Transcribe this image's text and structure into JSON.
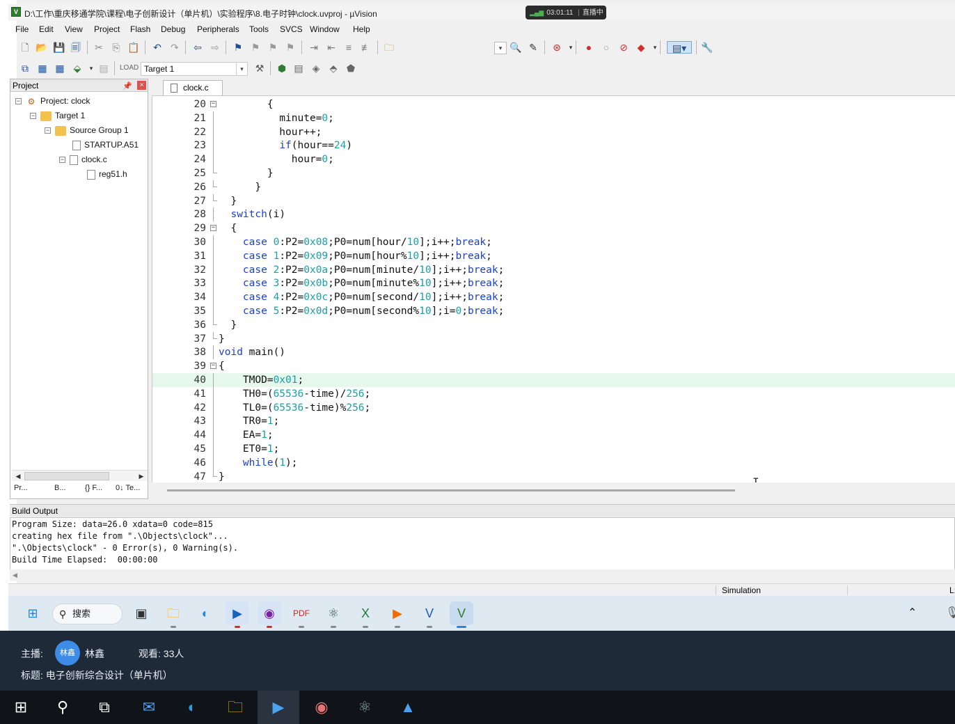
{
  "window": {
    "title": "D:\\工作\\重庆移通学院\\课程\\电子创新设计（单片机）\\实验程序\\8.电子时钟\\clock.uvproj - µVision",
    "live_time": "03:01:11",
    "live_status": "直播中"
  },
  "menu": [
    "File",
    "Edit",
    "View",
    "Project",
    "Flash",
    "Debug",
    "Peripherals",
    "Tools",
    "SVCS",
    "Window",
    "Help"
  ],
  "toolbar": {
    "target": "Target 1"
  },
  "project_panel": {
    "title": "Project",
    "tree": [
      {
        "label": "Project: clock"
      },
      {
        "label": "Target 1"
      },
      {
        "label": "Source Group 1"
      },
      {
        "label": "STARTUP.A51"
      },
      {
        "label": "clock.c"
      },
      {
        "label": "reg51.h"
      }
    ],
    "tabs": [
      "Pr...",
      "B...",
      "{} F...",
      "0↓ Te..."
    ]
  },
  "editor": {
    "active_tab": "clock.c",
    "lines": [
      {
        "n": "20",
        "html": "        {"
      },
      {
        "n": "21",
        "html": "          minute=<span class=\"num\">0</span>;"
      },
      {
        "n": "22",
        "html": "          hour++;"
      },
      {
        "n": "23",
        "html": "          <span class=\"kw\">if</span>(hour==<span class=\"num\">24</span>)"
      },
      {
        "n": "24",
        "html": "            hour=<span class=\"num\">0</span>;"
      },
      {
        "n": "25",
        "html": "        }"
      },
      {
        "n": "26",
        "html": "      }"
      },
      {
        "n": "27",
        "html": "  }"
      },
      {
        "n": "28",
        "html": "  <span class=\"kw\">switch</span>(i)"
      },
      {
        "n": "29",
        "html": "  {"
      },
      {
        "n": "30",
        "html": "    <span class=\"kw\">case</span> <span class=\"num\">0</span>:P2=<span class=\"num\">0x08</span>;P0=num[hour/<span class=\"num\">10</span>];i++;<span class=\"kw\">break</span>;"
      },
      {
        "n": "31",
        "html": "    <span class=\"kw\">case</span> <span class=\"num\">1</span>:P2=<span class=\"num\">0x09</span>;P0=num[hour%<span class=\"num\">10</span>];i++;<span class=\"kw\">break</span>;"
      },
      {
        "n": "32",
        "html": "    <span class=\"kw\">case</span> <span class=\"num\">2</span>:P2=<span class=\"num\">0x0a</span>;P0=num[minute/<span class=\"num\">10</span>];i++;<span class=\"kw\">break</span>;"
      },
      {
        "n": "33",
        "html": "    <span class=\"kw\">case</span> <span class=\"num\">3</span>:P2=<span class=\"num\">0x0b</span>;P0=num[minute%<span class=\"num\">10</span>];i++;<span class=\"kw\">break</span>;"
      },
      {
        "n": "34",
        "html": "    <span class=\"kw\">case</span> <span class=\"num\">4</span>:P2=<span class=\"num\">0x0c</span>;P0=num[second/<span class=\"num\">10</span>];i++;<span class=\"kw\">break</span>;"
      },
      {
        "n": "35",
        "html": "    <span class=\"kw\">case</span> <span class=\"num\">5</span>:P2=<span class=\"num\">0x0d</span>;P0=num[second%<span class=\"num\">10</span>];i=<span class=\"num\">0</span>;<span class=\"kw\">break</span>;"
      },
      {
        "n": "36",
        "html": "  }"
      },
      {
        "n": "37",
        "html": "}"
      },
      {
        "n": "38",
        "html": "<span class=\"kw\">void</span> main()"
      },
      {
        "n": "39",
        "html": "{"
      },
      {
        "n": "40",
        "html": "    TMOD=<span class=\"num\">0x01</span>;"
      },
      {
        "n": "41",
        "html": "    TH0=(<span class=\"num\">65536</span>-time)/<span class=\"num\">256</span>;"
      },
      {
        "n": "42",
        "html": "    TL0=(<span class=\"num\">65536</span>-time)%<span class=\"num\">256</span>;"
      },
      {
        "n": "43",
        "html": "    TR0=<span class=\"num\">1</span>;"
      },
      {
        "n": "44",
        "html": "    EA=<span class=\"num\">1</span>;"
      },
      {
        "n": "45",
        "html": "    ET0=<span class=\"num\">1</span>;"
      },
      {
        "n": "46",
        "html": "    <span class=\"kw\">while</span>(<span class=\"num\">1</span>);"
      },
      {
        "n": "47",
        "html": "}"
      }
    ]
  },
  "build_output": {
    "title": "Build Output",
    "lines": [
      "Program Size: data=26.0 xdata=0 code=815",
      "creating hex file from \".\\Objects\\clock\"...",
      "\".\\Objects\\clock\" - 0 Error(s), 0 Warning(s).",
      "Build Time Elapsed:  00:00:00"
    ]
  },
  "statusbar": {
    "mode": "Simulation",
    "trailing": "L:"
  },
  "inner_taskbar": {
    "search_label": "搜索"
  },
  "stream": {
    "host_label": "主播:",
    "avatar_text": "林鑫",
    "host_name": "林鑫",
    "viewers": "观看: 33人",
    "title": "标题: 电子创新综合设计（单片机）"
  },
  "colors": {
    "keyword": "#1a3fcf",
    "number": "#1a9fa6",
    "current_line": "#e6f8ec",
    "stream_bg": "#1f2a38",
    "taskbar_bg": "#101418"
  }
}
